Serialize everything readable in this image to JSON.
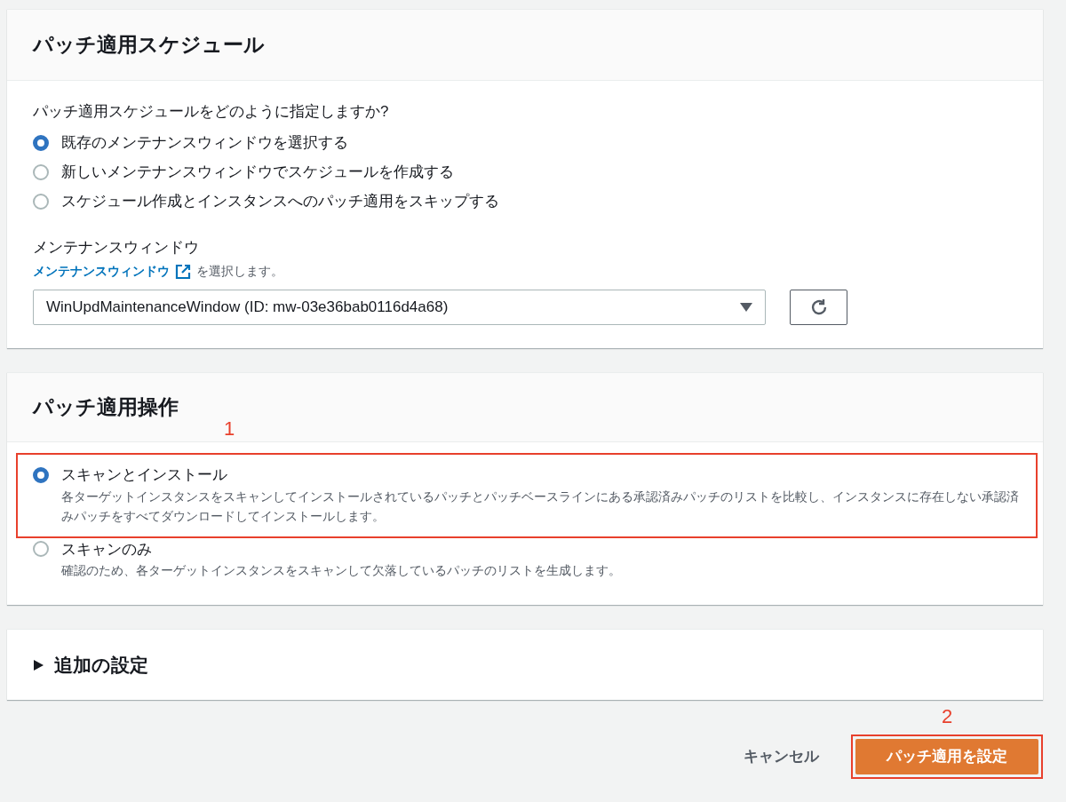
{
  "schedule": {
    "title": "パッチ適用スケジュール",
    "question": "パッチ適用スケジュールをどのように指定しますか?",
    "options": [
      {
        "label": "既存のメンテナンスウィンドウを選択する",
        "selected": true
      },
      {
        "label": "新しいメンテナンスウィンドウでスケジュールを作成する",
        "selected": false
      },
      {
        "label": "スケジュール作成とインスタンスへのパッチ適用をスキップする",
        "selected": false
      }
    ],
    "window_label": "メンテナンスウィンドウ",
    "window_link": "メンテナンスウィンドウ",
    "window_hint": "を選択します。",
    "window_select": {
      "value": "WinUpdMaintenanceWindow (ID: mw-03e36bab0116d4a68)"
    }
  },
  "operation": {
    "title": "パッチ適用操作",
    "options": [
      {
        "label": "スキャンとインストール",
        "description": "各ターゲットインスタンスをスキャンしてインストールされているパッチとパッチベースラインにある承認済みパッチのリストを比較し、インスタンスに存在しない承認済みパッチをすべてダウンロードしてインストールします。",
        "selected": true,
        "callout": "1"
      },
      {
        "label": "スキャンのみ",
        "description": "確認のため、各ターゲットインスタンスをスキャンして欠落しているパッチのリストを生成します。",
        "selected": false
      }
    ]
  },
  "additional": {
    "title": "追加の設定",
    "expanded": false
  },
  "footer": {
    "cancel": "キャンセル",
    "submit": "パッチ適用を設定",
    "submit_callout": "2"
  }
}
